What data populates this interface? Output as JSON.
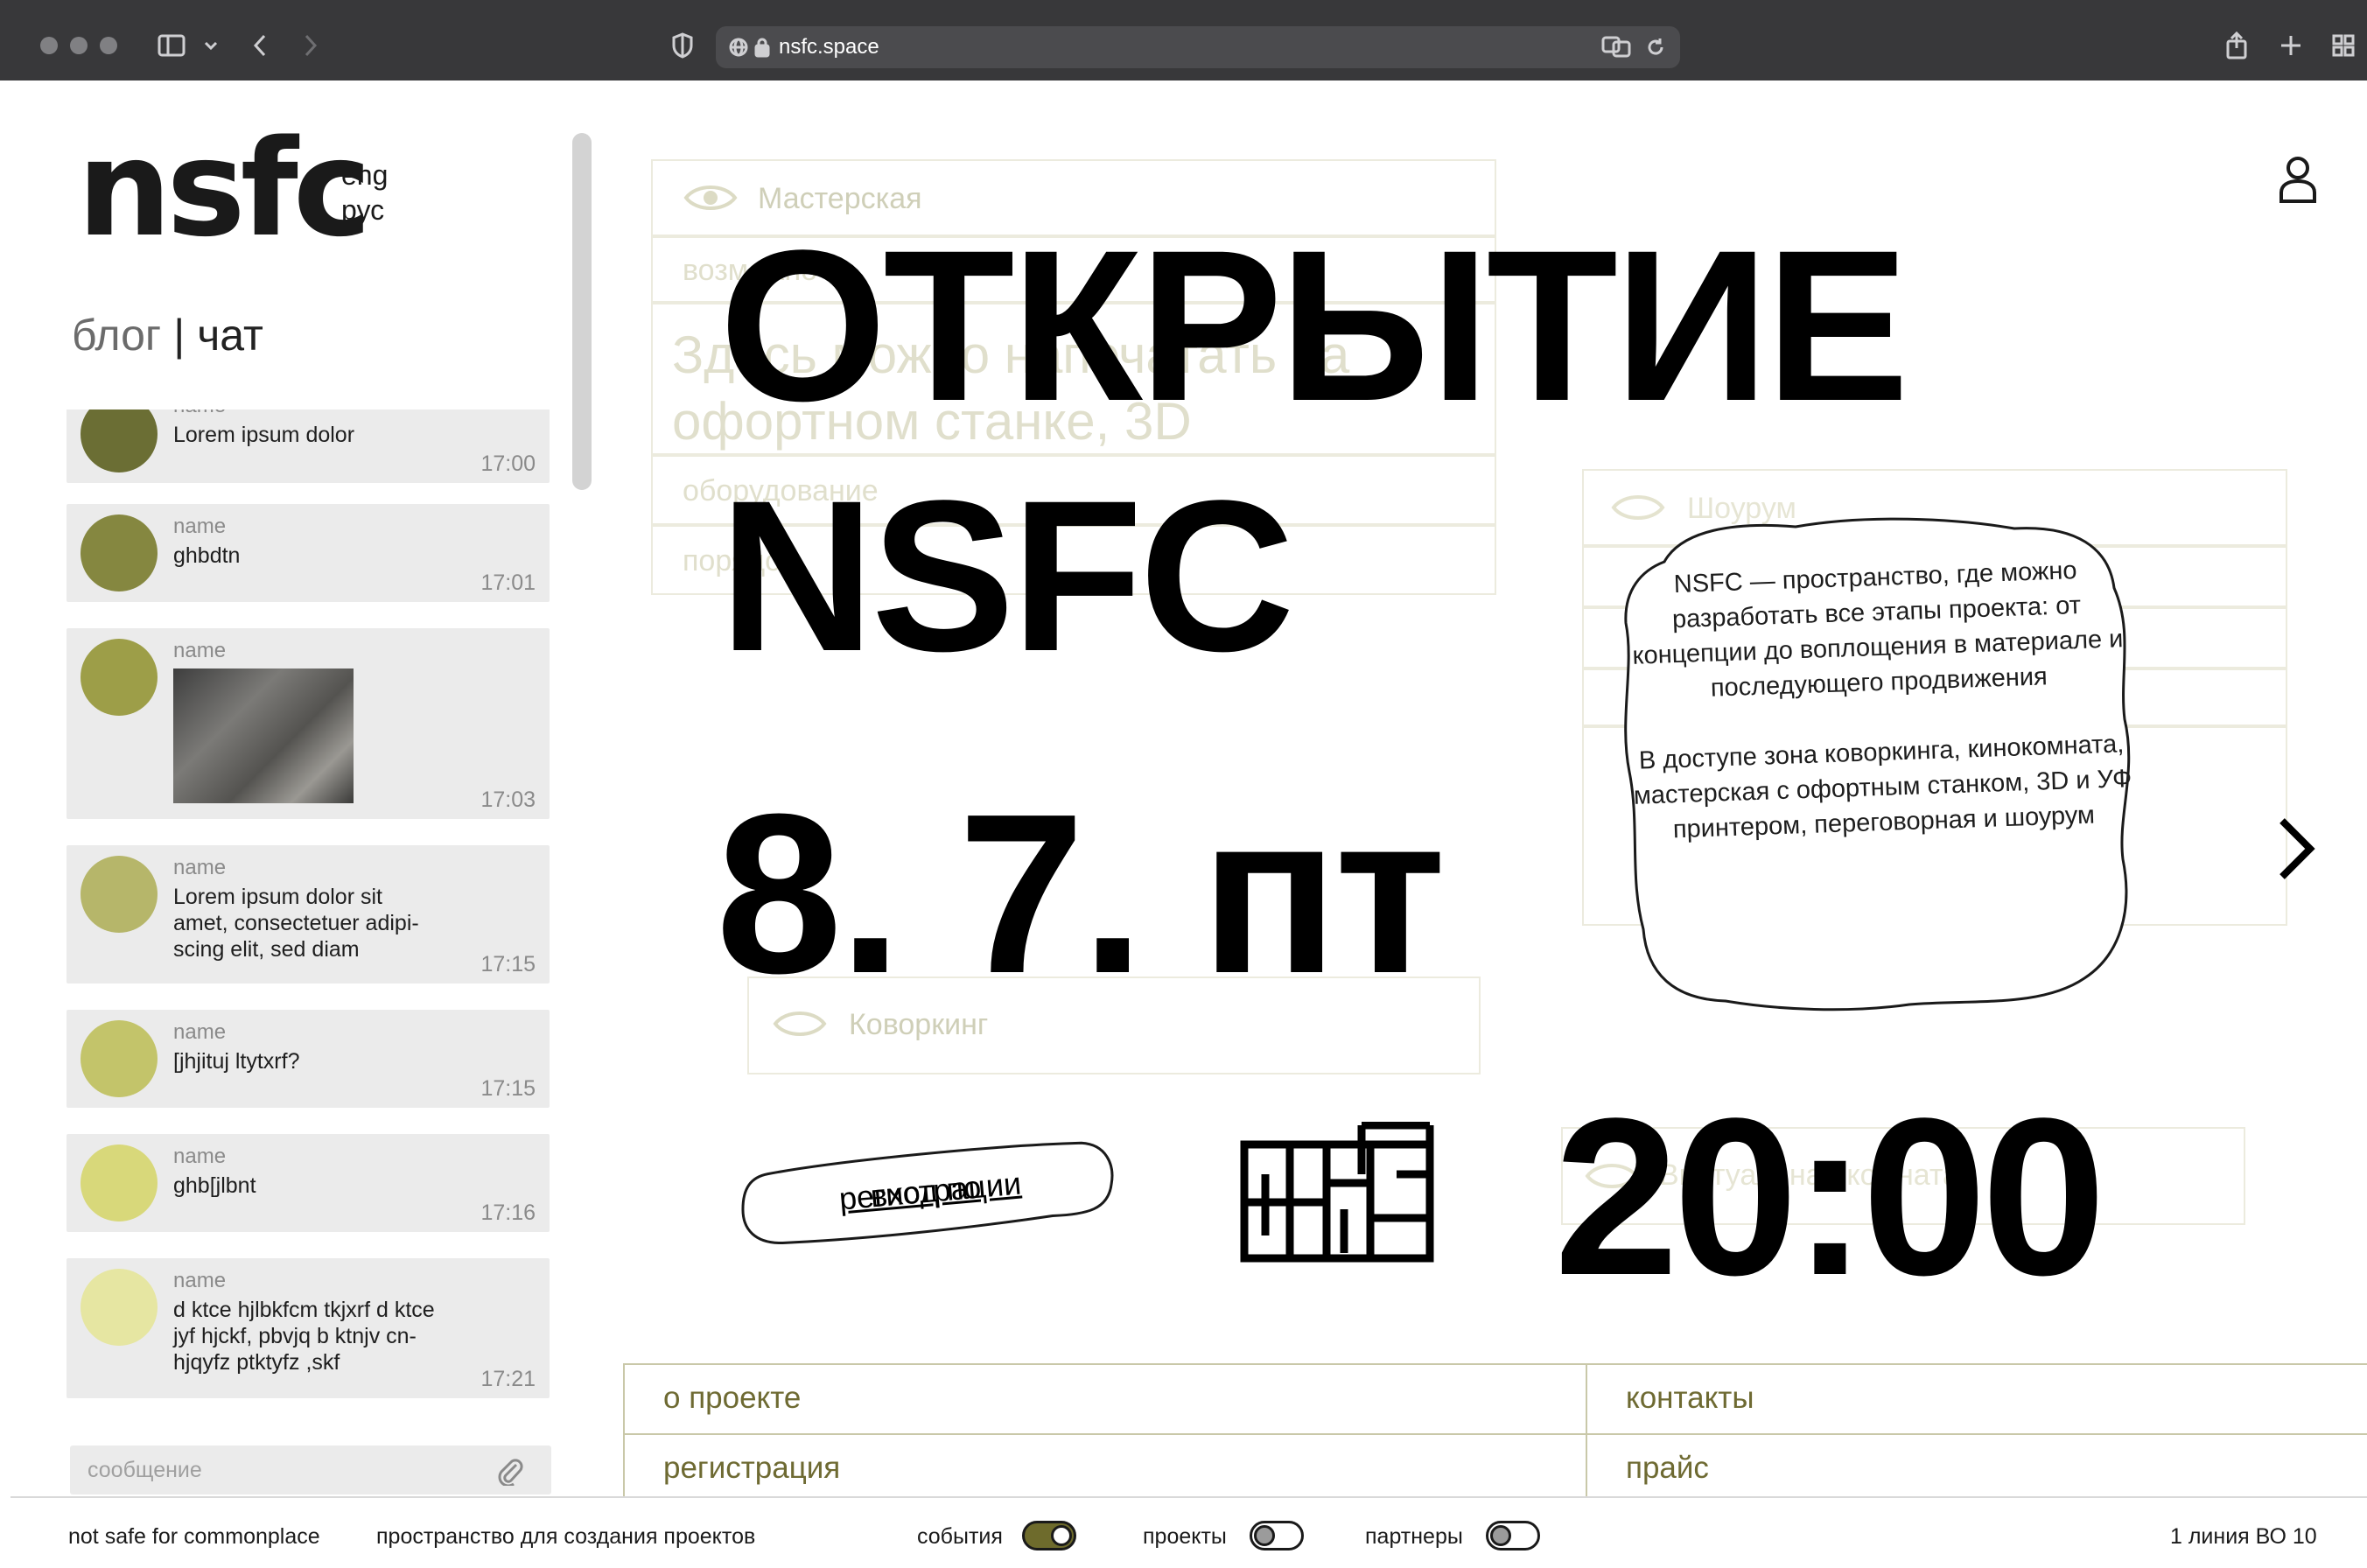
{
  "browser": {
    "url": "nsfc.space"
  },
  "site": {
    "logo": "nsfc",
    "lang_eng": "eng",
    "lang_rus": "рус",
    "user_icon": "user-icon"
  },
  "sidebar": {
    "tab_blog": "блог",
    "tab_separator": "|",
    "tab_chat": "чат",
    "input_placeholder": "сообщение",
    "messages": [
      {
        "name": "name",
        "text": "Lorem ipsum dolor",
        "time": "17:00",
        "avatar_color": "#6b6e34"
      },
      {
        "name": "name",
        "text": "ghbdtn",
        "time": "17:01",
        "avatar_color": "#858740"
      },
      {
        "name": "name",
        "text": "",
        "time": "17:03",
        "avatar_color": "#9d9e48",
        "has_image": true
      },
      {
        "name": "name",
        "text": "Lorem ipsum dolor sit amet, consectetuer adipi-scing elit, sed diam",
        "time": "17:15",
        "avatar_color": "#b6b66a"
      },
      {
        "name": "name",
        "text": "[jhjituj ltytxrf?",
        "time": "17:15",
        "avatar_color": "#c3c46a"
      },
      {
        "name": "name",
        "text": "ghb[jlbnt",
        "time": "17:16",
        "avatar_color": "#d8d87a"
      },
      {
        "name": "name",
        "text": "d ktce hjlbkfcm tkjxrf d ktce jyf hjckf, pbvjq b ktnjv cn-hjqyfz ptktyfz ,skf",
        "time": "17:21",
        "avatar_color": "#e6e6a2"
      }
    ]
  },
  "background_panels": {
    "workshop_title": "Мастерская",
    "workshop_row1": "возможно",
    "workshop_body": "Здесь можно напечатать на офортном станке, 3D",
    "workshop_row2": "оборудование",
    "workshop_row3": "порядок",
    "showroom_title": "Шоурум",
    "coworking_title": "Коворкинг",
    "virtual_title": "Виртуальная комната"
  },
  "headline": {
    "line1": "ОТКРЫТИЕ",
    "line2": "NSFC",
    "date": "8. 7. пт",
    "time": "20:00"
  },
  "bubble": {
    "para1": "NSFC — пространство, где можно разработать все этапы проекта: от концепции до воплощения в материале и последующего продвижения",
    "para2": "В доступе зона коворкинга, кинокомната, мастерская с офортным станком, 3D и УФ принтером, переговорная и шоурум"
  },
  "registration_badge": {
    "prefix": "вход по",
    "link": "регистрации"
  },
  "nav_grid": {
    "about": "о проекте",
    "contacts": "контакты",
    "registration": "регистрация",
    "price": "прайс"
  },
  "footer": {
    "brand": "not safe for commonplace",
    "tagline": "пространство для создания проектов",
    "toggle_events": "события",
    "toggle_projects": "проекты",
    "toggle_partners": "партнеры",
    "address": "1 линия ВО 10"
  },
  "toggles": {
    "events": true,
    "projects": false,
    "partners": false
  },
  "colors": {
    "accent": "#6e6a32",
    "grid_border": "#c9c8a9",
    "chat_bg": "#ebebeb"
  }
}
